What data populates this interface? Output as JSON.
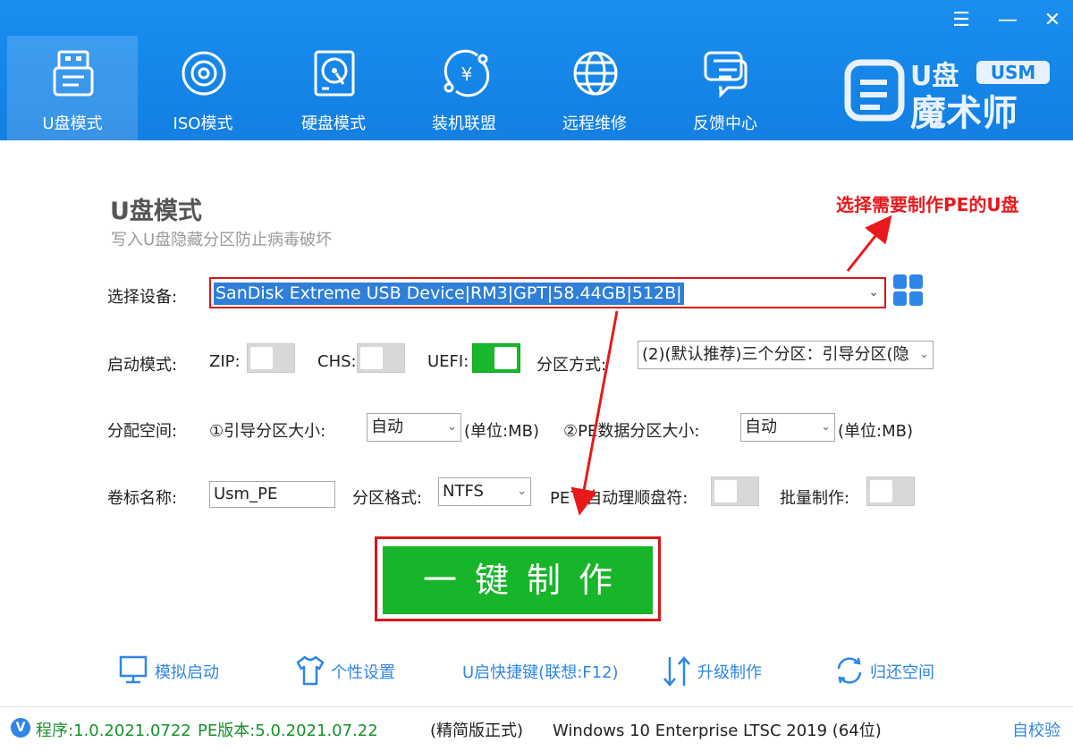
{
  "window_controls": {
    "menu": "☰",
    "minimize": "—",
    "close": "✕"
  },
  "nav": [
    {
      "label": "U盘模式",
      "icon": "usb-drive-icon",
      "active": true
    },
    {
      "label": "ISO模式",
      "icon": "disc-icon",
      "active": false
    },
    {
      "label": "硬盘模式",
      "icon": "hard-disk-icon",
      "active": false
    },
    {
      "label": "装机联盟",
      "icon": "yen-coin-icon",
      "active": false
    },
    {
      "label": "远程维修",
      "icon": "globe-icon",
      "active": false
    },
    {
      "label": "反馈中心",
      "icon": "chat-bubble-icon",
      "active": false
    }
  ],
  "logo": {
    "line1": "U盘",
    "badge": "USM",
    "line2": "魔术师"
  },
  "page": {
    "title": "U盘模式",
    "subtitle": "写入U盘隐藏分区防止病毒破坏"
  },
  "annotation": "选择需要制作PE的U盘",
  "form": {
    "device_label": "选择设备:",
    "device_value": "SanDisk Extreme USB Device|RM3|GPT|58.44GB|512B|",
    "boot_label": "启动模式:",
    "zip_label": "ZIP:",
    "chs_label": "CHS:",
    "uefi_label": "UEFI:",
    "toggles": {
      "zip": false,
      "chs": false,
      "uefi": true,
      "pe_reorder": false,
      "batch": false
    },
    "partition_mode_label": "分区方式:",
    "partition_mode_value": "(2)(默认推荐)三个分区：引导分区(隐",
    "alloc_label": "分配空间:",
    "boot_size_label": "①引导分区大小:",
    "boot_size_value": "自动",
    "unit1": "(单位:MB)",
    "pe_size_label": "②PE数据分区大小:",
    "pe_size_value": "自动",
    "unit2": "(单位:MB)",
    "volume_label": "卷标名称:",
    "volume_value": "Usm_PE",
    "fs_label": "分区格式:",
    "fs_value": "NTFS",
    "pe_reorder_label": "PE下自动理顺盘符:",
    "batch_label": "批量制作:"
  },
  "make_button": "一键制作",
  "tools": [
    {
      "label": "模拟启动",
      "icon": "monitor-icon"
    },
    {
      "label": "个性设置",
      "icon": "tshirt-icon"
    },
    {
      "label": "U启快捷键(联想:F12)",
      "icon": ""
    },
    {
      "label": "升级制作",
      "icon": "upgrade-arrows-icon"
    },
    {
      "label": "归还空间",
      "icon": "refresh-icon"
    }
  ],
  "footer": {
    "badge": "V",
    "program_version": "程序:1.0.2021.0722",
    "pe_version": "PE版本:5.0.2021.07.22",
    "edition": "(精简版正式)",
    "os": "Windows 10 Enterprise LTSC 2019 (64位)",
    "self_check": "自校验"
  },
  "colors": {
    "header_blue": "#1585e8",
    "accent_green": "#17b52a",
    "highlight_red": "#d6161b",
    "link_blue": "#2f86e6"
  }
}
